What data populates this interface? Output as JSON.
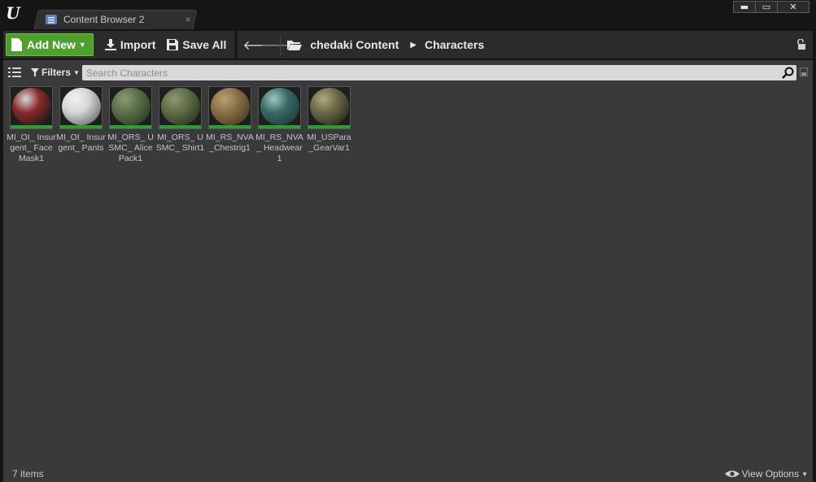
{
  "tab": {
    "title": "Content Browser 2",
    "close_glyph": "×"
  },
  "window_controls": {
    "minimize": "▬",
    "maximize": "▭",
    "close": "✕"
  },
  "toolbar": {
    "add_new_label": "Add New",
    "import_label": "Import",
    "save_all_label": "Save All"
  },
  "breadcrumb": {
    "root": "chedaki Content",
    "current": "Characters"
  },
  "filters": {
    "label": "Filters",
    "search_placeholder": "Search Characters"
  },
  "assets": [
    {
      "name": "MI_OI_ Insurgent_ FaceMask1",
      "colors": [
        "#8a2a2a",
        "#1c1c1c",
        "#d8d8d8"
      ]
    },
    {
      "name": "MI_OI_ Insurgent_ Pants",
      "colors": [
        "#d6d6d6",
        "#6a6a6a",
        "#f2f2f2"
      ]
    },
    {
      "name": "MI_ORS_ USMC_ AlicePack1",
      "colors": [
        "#5a7048",
        "#2d3a24",
        "#8a9a70"
      ]
    },
    {
      "name": "MI_ORS_ USMC_ Shirt1",
      "colors": [
        "#5f6e48",
        "#2c3620",
        "#8c9770"
      ]
    },
    {
      "name": "MI_RS_NVA _Chestrig1",
      "colors": [
        "#8a7048",
        "#4a3a22",
        "#b8a070"
      ]
    },
    {
      "name": "MI_RS_NVA _ Headwear1",
      "colors": [
        "#3a6a66",
        "#1e3a3a",
        "#a0c8c2"
      ]
    },
    {
      "name": "MI_USPara _GearVar1",
      "colors": [
        "#6a6a48",
        "#2a2a1c",
        "#b0a880"
      ]
    }
  ],
  "status": {
    "item_count": "7 items",
    "view_options": "View Options"
  },
  "colors": {
    "accent_green": "#4f9f2f",
    "asset_bar": "#2e9d32",
    "panel": "#3a3a3c"
  }
}
